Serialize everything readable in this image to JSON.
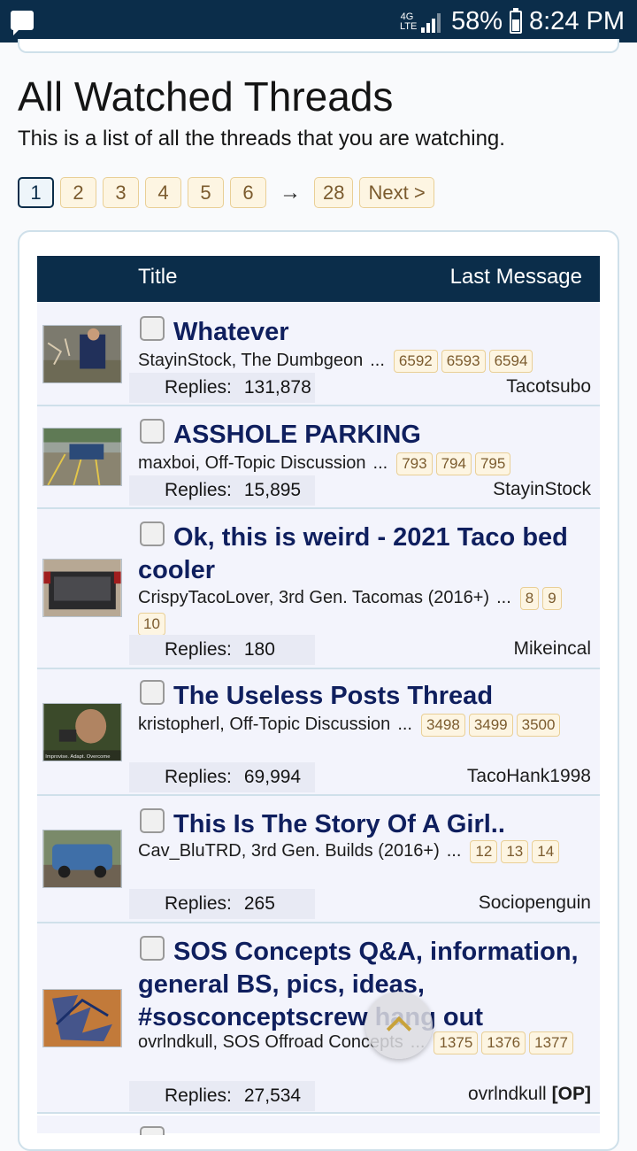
{
  "status": {
    "network": "4G LTE",
    "battery": "58%",
    "time": "8:24 PM"
  },
  "page": {
    "title": "All Watched Threads",
    "description": "This is a list of all the threads that you are watching."
  },
  "pagination": {
    "pages": [
      "1",
      "2",
      "3",
      "4",
      "5",
      "6"
    ],
    "current": "1",
    "arrow": "→",
    "last": "28",
    "next": "Next >"
  },
  "table": {
    "col_title": "Title",
    "col_last": "Last Message",
    "replies_label": "Replies:",
    "rows": [
      {
        "title": "Whatever",
        "author": "StayinStock",
        "forum": "The Dumbgeon",
        "pages": [
          "6592",
          "6593",
          "6594"
        ],
        "replies": "131,878",
        "last_user": "Tacotsubo",
        "op": ""
      },
      {
        "title": "ASSHOLE PARKING",
        "author": "maxboi",
        "forum": "Off-Topic Discussion",
        "pages": [
          "793",
          "794",
          "795"
        ],
        "replies": "15,895",
        "last_user": "StayinStock",
        "op": ""
      },
      {
        "title": "Ok, this is weird - 2021 Taco bed cooler",
        "author": "CrispyTacoLover",
        "forum": "3rd Gen. Tacomas (2016+)",
        "pages": [
          "8",
          "9",
          "10"
        ],
        "replies": "180",
        "last_user": "Mikeincal",
        "op": ""
      },
      {
        "title": "The Useless Posts Thread",
        "author": "kristopherl",
        "forum": "Off-Topic Discussion",
        "pages": [
          "3498",
          "3499",
          "3500"
        ],
        "replies": "69,994",
        "last_user": "TacoHank1998",
        "op": ""
      },
      {
        "title": "This Is The Story Of A Girl..",
        "author": "Cav_BluTRD",
        "forum": "3rd Gen. Builds (2016+)",
        "pages": [
          "12",
          "13",
          "14"
        ],
        "replies": "265",
        "last_user": "Sociopenguin",
        "op": ""
      },
      {
        "title": "SOS Concepts Q&A, information, general BS, pics, ideas, #sosconceptscrew hang out",
        "author": "ovrlndkull",
        "forum": "SOS Offroad Concepts",
        "pages": [
          "1375",
          "1376",
          "1377"
        ],
        "replies": "27,534",
        "last_user": "ovrlndkull",
        "op": "[OP]"
      }
    ]
  },
  "thumb_caption": "Improvise. Adapt. Overcome"
}
